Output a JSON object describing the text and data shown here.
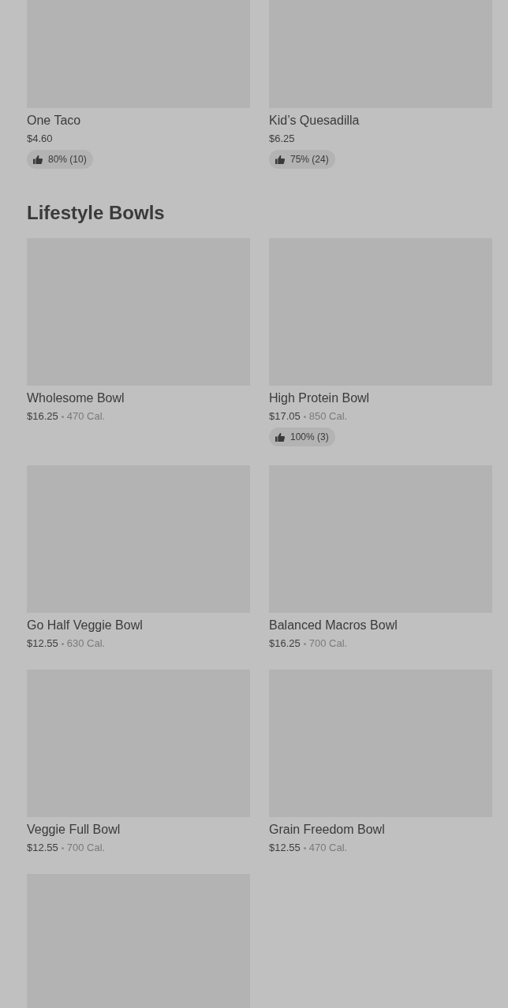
{
  "sections": [
    {
      "kind": "continued",
      "items": [
        {
          "kind": "full",
          "name": "One Taco",
          "price": "$4.60",
          "rating": "80% (10)"
        },
        {
          "kind": "full",
          "name": "Kid’s Quesadilla",
          "price": "$6.25",
          "rating": "75% (24)"
        }
      ]
    },
    {
      "kind": "titled",
      "title": "Lifestyle Bowls",
      "items": [
        {
          "kind": "full",
          "name": "Wholesome Bowl",
          "price": "$16.25",
          "calories": "470 Cal."
        },
        {
          "kind": "full",
          "name": "High Protein Bowl",
          "price": "$17.05",
          "calories": "850 Cal.",
          "rating": "100% (3)"
        },
        {
          "kind": "full",
          "name": "Go Half Veggie Bowl",
          "price": "$12.55",
          "calories": "630 Cal."
        },
        {
          "kind": "full",
          "name": "Balanced Macros Bowl",
          "price": "$16.25",
          "calories": "700 Cal."
        },
        {
          "kind": "full",
          "name": "Veggie Full Bowl",
          "price": "$12.55",
          "calories": "700 Cal."
        },
        {
          "kind": "full",
          "name": "Grain Freedom Bowl",
          "price": "$12.55",
          "calories": "470 Cal."
        },
        {
          "kind": "image_only"
        }
      ]
    }
  ]
}
